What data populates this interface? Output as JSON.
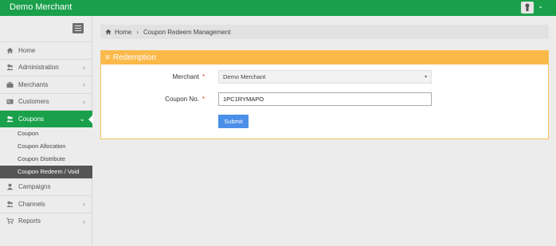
{
  "app": {
    "brand": "Demo Merchant"
  },
  "sidebar": {
    "items": [
      {
        "label": "Home",
        "icon": "home-icon"
      },
      {
        "label": "Administration",
        "icon": "users-icon"
      },
      {
        "label": "Merchants",
        "icon": "briefcase-icon"
      },
      {
        "label": "Customers",
        "icon": "id-card-icon"
      },
      {
        "label": "Coupons",
        "icon": "users-group-icon",
        "active": true
      },
      {
        "label": "Campaigns",
        "icon": "user-icon"
      },
      {
        "label": "Channels",
        "icon": "users-icon"
      },
      {
        "label": "Reports",
        "icon": "cart-icon"
      }
    ],
    "coupon_sub": [
      {
        "label": "Coupon"
      },
      {
        "label": "Coupon Allocation"
      },
      {
        "label": "Coupon Distribute"
      },
      {
        "label": "Coupon Redeem / Void",
        "current": true
      }
    ]
  },
  "breadcrumb": {
    "home": "Home",
    "current": "Coupon Redeem Management"
  },
  "panel": {
    "title": "Redemption",
    "merchant_label": "Merchant",
    "merchant_value": "Demo Merchant",
    "coupon_label": "Coupon No.",
    "coupon_value": "1PC1RYMAPO",
    "required_mark": "*",
    "submit_label": "Submit"
  },
  "colors": {
    "accent": "#1aa04b",
    "panel": "#fbb94a",
    "button": "#4a8fe8"
  }
}
